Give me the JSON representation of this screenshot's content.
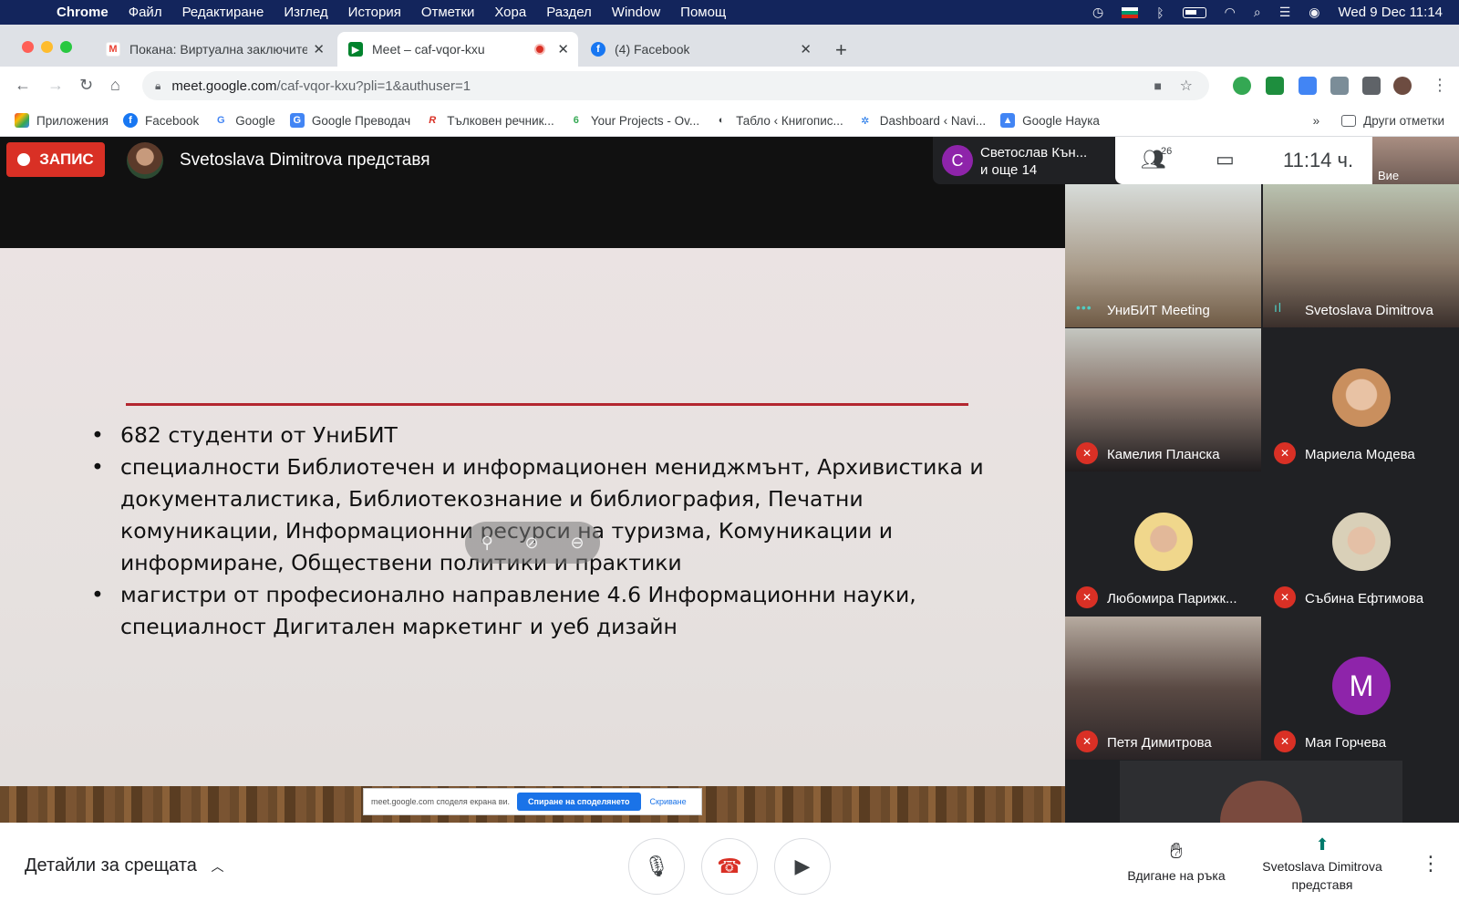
{
  "macos": {
    "app_name": "Chrome",
    "menu": [
      "Файл",
      "Редактиране",
      "Изглед",
      "История",
      "Отметки",
      "Хора",
      "Раздел",
      "Window",
      "Помощ"
    ],
    "datetime": "Wed 9 Dec  11:14"
  },
  "tabs": [
    {
      "title": "Покана: Виртуална заключите",
      "favicon": "gmail-icon"
    },
    {
      "title": "Meet – caf-vqor-kxu",
      "favicon": "meet-icon"
    },
    {
      "title": "(4) Facebook",
      "favicon": "facebook-icon"
    }
  ],
  "address": {
    "host": "meet.google.com",
    "path": "/caf-vqor-kxu?pli=1&authuser=1"
  },
  "bookmarks": [
    {
      "label": "Приложения",
      "color": "#ea4335"
    },
    {
      "label": "Facebook",
      "color": "#1877f2"
    },
    {
      "label": "Google",
      "color": "#4285f4"
    },
    {
      "label": "Google Преводач",
      "color": "#4285f4"
    },
    {
      "label": "Тълковен речник...",
      "color": "#d93025"
    },
    {
      "label": "Your Projects - Ov...",
      "color": "#34a853"
    },
    {
      "label": "Табло ‹ Книгопис...",
      "color": "#3c4043"
    },
    {
      "label": "Dashboard ‹ Navi...",
      "color": "#1a73e8"
    },
    {
      "label": "Google Наука",
      "color": "#4285f4"
    }
  ],
  "bookmarks_more": "»",
  "bookmarks_other": "Други отметки",
  "meet": {
    "record_label": "ЗАПИС",
    "presenter_text": "Svetoslava Dimitrova представя",
    "viewer_initial": "С",
    "viewer_name": "Светослав Кън...",
    "viewer_more": "и още 14",
    "participant_count": "26",
    "clock": "11:14 ч.",
    "self_label": "Вие"
  },
  "slide": {
    "bullets": [
      "682 студенти от УниБИТ",
      "специалности Библиотечен и информационен мениджмънт,  Архивистика и документалистика, Библиотекознание и библиография, Печатни комуникации, Информационни ресурси на туризма, Комуникации и информиране, Обществени политики и практики",
      "магистри от професионално направление 4.6 Информационни науки, специалност Дигитален маркетинг и уеб дизайн"
    ]
  },
  "share_bar": {
    "text": "meet.google.com споделя екрана ви.",
    "stop_label": "Спиране на споделянето",
    "hide_label": "Скриване"
  },
  "participants": [
    {
      "name": "УниБИТ Meeting",
      "state": "speaking"
    },
    {
      "name": "Svetoslava Dimitrova",
      "state": "speaking"
    },
    {
      "name": "Камелия Планска",
      "state": "muted"
    },
    {
      "name": "Мариела Модева",
      "state": "muted"
    },
    {
      "name": "Любомира Парижк...",
      "state": "muted"
    },
    {
      "name": "Събина Ефтимова",
      "state": "muted"
    },
    {
      "name": "Петя Димитрова",
      "state": "muted"
    },
    {
      "name": "Мая Горчева",
      "state": "muted",
      "initial": "М"
    }
  ],
  "bottom": {
    "details_label": "Детайли за срещата",
    "raise_hand_label": "Вдигане на ръка",
    "presenting_label": "Svetoslava Dimitrova представя"
  },
  "colors": {
    "record_red": "#d93025",
    "slide_rule": "#b3262f",
    "avatar_purple": "#8e24aa",
    "mac_menubar": "#13255c"
  }
}
